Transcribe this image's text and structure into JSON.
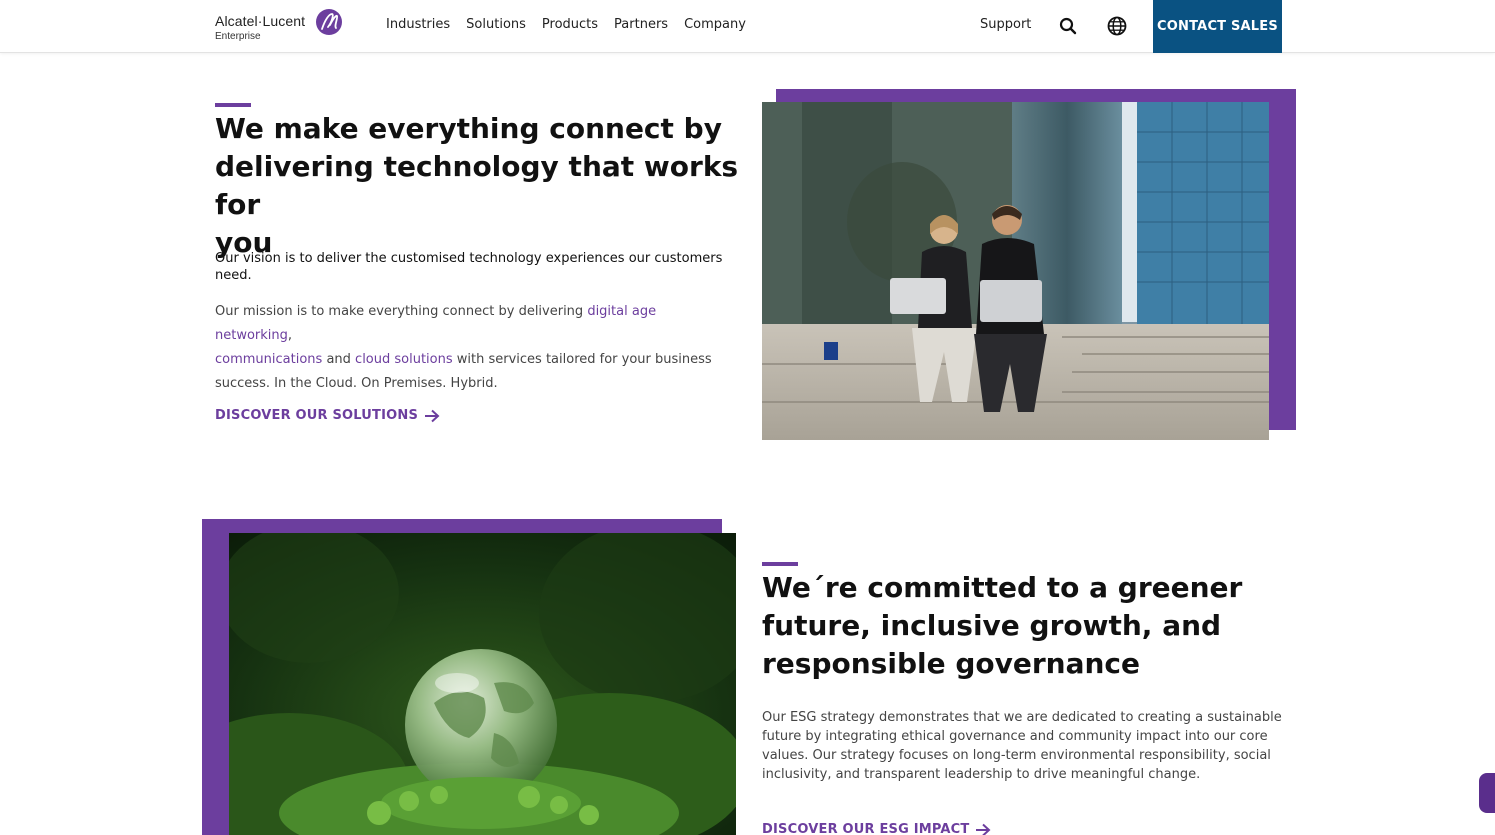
{
  "brand": {
    "name": "Alcatel·Lucent",
    "sub": "Enterprise",
    "accent": "#6c3e9e",
    "cta_bg": "#0a5282"
  },
  "nav": {
    "items": [
      "Industries",
      "Solutions",
      "Products",
      "Partners",
      "Company"
    ],
    "support": "Support",
    "contact_label": "CONTACT SALES",
    "icons": [
      "search-icon",
      "globe-icon"
    ]
  },
  "section1": {
    "heading_lines": [
      "We make everything connect by",
      "delivering technology that works for",
      "you"
    ],
    "vision": "Our vision is to deliver the customised technology experiences our customers need.",
    "mission_before": "Our mission is to make everything connect by delivering ",
    "mission_link1": "digital age networking",
    "mission_comma": ",",
    "mission_link2": "communications",
    "mission_and": " and ",
    "mission_link3": "cloud solutions",
    "mission_after": " with services tailored for your business success. In the Cloud. On Premises. Hybrid.",
    "cta": "DISCOVER OUR SOLUTIONS"
  },
  "section2": {
    "heading_lines": [
      "We´re committed to a greener",
      "future, inclusive growth, and",
      "responsible governance"
    ],
    "body": "Our ESG strategy demonstrates that we are dedicated to creating a sustainable future by integrating ethical governance and community impact into our core values. Our strategy focuses on long-term environmental responsibility, social inclusivity, and transparent leadership to drive meaningful change.",
    "cta": "DISCOVER OUR ESG IMPACT"
  }
}
